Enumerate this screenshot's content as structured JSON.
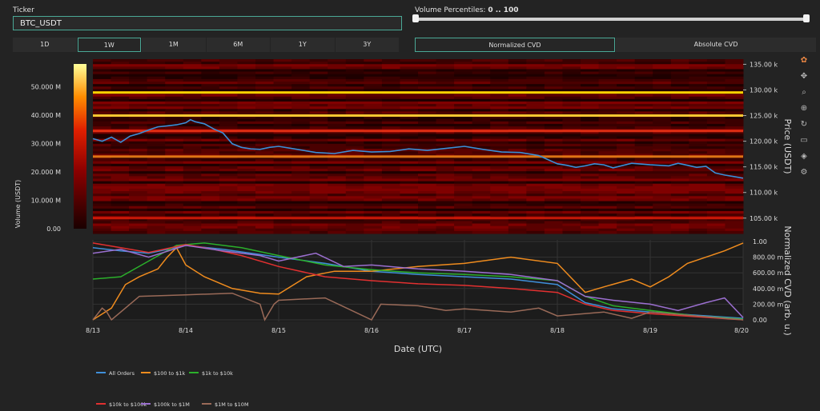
{
  "ticker": {
    "label": "Ticker",
    "value": "BTC_USDT"
  },
  "ranges": [
    "1D",
    "1W",
    "1M",
    "6M",
    "1Y",
    "3Y"
  ],
  "active_range": "1W",
  "volume_percentiles": {
    "label": "Volume Percentiles:",
    "value": "0 .. 100",
    "low": 0,
    "high": 100
  },
  "cvd_modes": [
    "Normalized CVD",
    "Absolute CVD"
  ],
  "active_cvd_mode": "Normalized CVD",
  "colors": {
    "accent": "#4aa896",
    "price_line": "#3a8fd8"
  },
  "chart_data": [
    {
      "type": "heatmap",
      "title": "",
      "ylabel": "Price (USDT)",
      "ylim": [
        102000,
        136000
      ],
      "y_ticks": [
        "135.00 k",
        "130.00 k",
        "125.00 k",
        "120.00 k",
        "115.00 k",
        "110.00 k",
        "105.00 k"
      ],
      "y_tick_values": [
        135000,
        130000,
        125000,
        120000,
        115000,
        110000,
        105000
      ],
      "colorbar": {
        "label": "Volume (USDT)",
        "ticks": [
          "50.000 M",
          "40.000 M",
          "30.000 M",
          "20.000 M",
          "10.000 M",
          "0.00"
        ],
        "tick_values": [
          50,
          40,
          30,
          20,
          10,
          0
        ],
        "range": [
          0,
          58
        ]
      },
      "x_range": [
        0,
        7
      ],
      "price_series": {
        "name": "Price",
        "x": [
          0,
          0.1,
          0.2,
          0.3,
          0.4,
          0.5,
          0.6,
          0.7,
          0.8,
          0.9,
          1.0,
          1.05,
          1.1,
          1.2,
          1.3,
          1.4,
          1.5,
          1.6,
          1.7,
          1.8,
          1.9,
          2.0,
          2.2,
          2.4,
          2.6,
          2.8,
          3.0,
          3.2,
          3.4,
          3.6,
          3.8,
          4.0,
          4.2,
          4.4,
          4.6,
          4.8,
          5.0,
          5.1,
          5.2,
          5.3,
          5.4,
          5.5,
          5.6,
          5.8,
          6.0,
          6.2,
          6.3,
          6.4,
          6.5,
          6.6,
          6.7,
          6.8,
          6.9,
          7.0
        ],
        "y": [
          120500,
          120000,
          120800,
          119800,
          121000,
          121500,
          122200,
          122800,
          123000,
          123200,
          123600,
          124200,
          123800,
          123400,
          122400,
          121600,
          119500,
          118800,
          118500,
          118400,
          118800,
          119000,
          118400,
          117800,
          117600,
          118200,
          117900,
          118000,
          118500,
          118200,
          118600,
          119000,
          118400,
          117900,
          117800,
          117200,
          115600,
          115300,
          114900,
          115200,
          115600,
          115400,
          114800,
          115700,
          115400,
          115200,
          115700,
          115300,
          114900,
          115100,
          113800,
          113400,
          113100,
          112800
        ]
      },
      "levels": [
        {
          "price": 129500,
          "intensity": 1.0
        },
        {
          "price": 125000,
          "intensity": 0.95
        },
        {
          "price": 117000,
          "intensity": 0.55
        },
        {
          "price": 122000,
          "intensity": 0.45
        },
        {
          "price": 105000,
          "intensity": 0.4
        }
      ]
    },
    {
      "type": "line",
      "ylabel": "Normalized CVD (arb. u.)",
      "xlabel": "Date (UTC)",
      "ylim": [
        -0.02,
        1.02
      ],
      "y_ticks": [
        "1.00",
        "800.00 m",
        "600.00 m",
        "400.00 m",
        "200.00 m",
        "0.00"
      ],
      "y_tick_values": [
        1.0,
        0.8,
        0.6,
        0.4,
        0.2,
        0.0
      ],
      "categories": [
        "8/13",
        "8/14",
        "8/15",
        "8/16",
        "8/17",
        "8/18",
        "8/19",
        "8/20"
      ],
      "x_range": [
        0,
        7
      ],
      "series": [
        {
          "name": "All Orders",
          "color": "#3f8fd9",
          "x": [
            0,
            0.3,
            0.6,
            1.0,
            1.4,
            2.0,
            2.5,
            3.0,
            3.5,
            4.0,
            4.5,
            5.0,
            5.3,
            5.6,
            6.0,
            6.5,
            7.0
          ],
          "y": [
            0.92,
            0.88,
            0.85,
            0.95,
            0.9,
            0.8,
            0.72,
            0.62,
            0.58,
            0.55,
            0.52,
            0.45,
            0.22,
            0.14,
            0.1,
            0.06,
            0.02
          ]
        },
        {
          "name": "$100 to $1k",
          "color": "#f08c1e",
          "x": [
            0,
            0.2,
            0.35,
            0.5,
            0.7,
            0.8,
            0.9,
            1.0,
            1.2,
            1.5,
            1.8,
            2.0,
            2.3,
            2.6,
            3.0,
            3.5,
            4.0,
            4.5,
            5.0,
            5.3,
            5.5,
            5.8,
            6.0,
            6.2,
            6.4,
            6.6,
            6.8,
            7.0
          ],
          "y": [
            0.0,
            0.15,
            0.45,
            0.55,
            0.65,
            0.8,
            0.92,
            0.7,
            0.55,
            0.4,
            0.34,
            0.33,
            0.55,
            0.62,
            0.62,
            0.68,
            0.72,
            0.8,
            0.72,
            0.35,
            0.42,
            0.52,
            0.42,
            0.55,
            0.72,
            0.8,
            0.88,
            0.98
          ]
        },
        {
          "name": "$1k to $10k",
          "color": "#2bb02b",
          "x": [
            0,
            0.3,
            0.6,
            0.9,
            1.2,
            1.6,
            2.0,
            2.5,
            3.0,
            3.5,
            4.0,
            4.5,
            5.0,
            5.3,
            5.6,
            6.0,
            6.5,
            7.0
          ],
          "y": [
            0.52,
            0.55,
            0.75,
            0.95,
            0.98,
            0.92,
            0.82,
            0.7,
            0.64,
            0.6,
            0.58,
            0.55,
            0.5,
            0.3,
            0.18,
            0.12,
            0.05,
            0.01
          ]
        },
        {
          "name": "$10k to $100k",
          "color": "#e23030",
          "x": [
            0,
            0.3,
            0.6,
            1.0,
            1.3,
            1.6,
            2.0,
            2.5,
            3.0,
            3.5,
            4.0,
            4.5,
            5.0,
            5.3,
            5.6,
            6.0,
            6.5,
            7.0
          ],
          "y": [
            0.98,
            0.92,
            0.86,
            0.96,
            0.9,
            0.82,
            0.68,
            0.55,
            0.5,
            0.46,
            0.44,
            0.4,
            0.35,
            0.2,
            0.12,
            0.08,
            0.04,
            0.0
          ]
        },
        {
          "name": "$100k to $1M",
          "color": "#9b6fd0",
          "x": [
            0,
            0.3,
            0.6,
            1.0,
            1.4,
            1.8,
            2.0,
            2.4,
            2.7,
            3.0,
            3.5,
            4.0,
            4.5,
            5.0,
            5.3,
            5.6,
            6.0,
            6.3,
            6.6,
            6.8,
            7.0
          ],
          "y": [
            0.85,
            0.9,
            0.8,
            0.95,
            0.88,
            0.82,
            0.75,
            0.85,
            0.68,
            0.7,
            0.65,
            0.62,
            0.58,
            0.5,
            0.3,
            0.25,
            0.2,
            0.12,
            0.22,
            0.28,
            0.03
          ]
        },
        {
          "name": "$1M to $10M",
          "color": "#9a6a58",
          "x": [
            0,
            0.1,
            0.15,
            0.2,
            0.5,
            1.0,
            1.5,
            1.8,
            1.85,
            1.95,
            2.0,
            2.5,
            3.0,
            3.1,
            3.5,
            3.8,
            4.0,
            4.5,
            4.8,
            5.0,
            5.5,
            5.8,
            6.0,
            6.5,
            7.0
          ],
          "y": [
            0.0,
            0.15,
            0.1,
            0.0,
            0.3,
            0.32,
            0.34,
            0.2,
            0.0,
            0.2,
            0.25,
            0.28,
            0.0,
            0.2,
            0.18,
            0.12,
            0.14,
            0.1,
            0.15,
            0.05,
            0.1,
            0.02,
            0.1,
            0.05,
            0.0
          ]
        }
      ]
    }
  ]
}
